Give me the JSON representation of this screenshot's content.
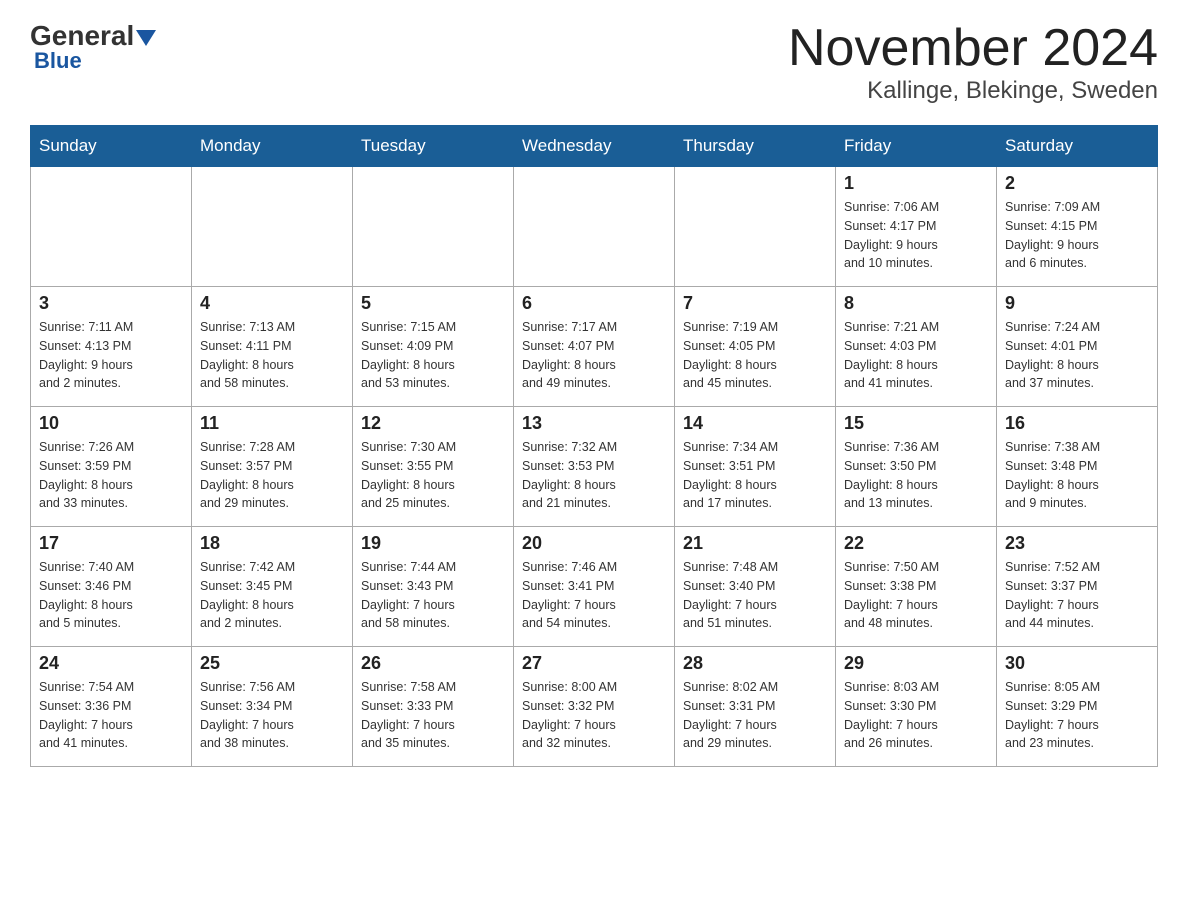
{
  "header": {
    "logo_general": "General",
    "logo_blue": "Blue",
    "month_year": "November 2024",
    "location": "Kallinge, Blekinge, Sweden"
  },
  "weekdays": [
    "Sunday",
    "Monday",
    "Tuesday",
    "Wednesday",
    "Thursday",
    "Friday",
    "Saturday"
  ],
  "weeks": [
    {
      "days": [
        {
          "num": "",
          "info": "",
          "empty": true
        },
        {
          "num": "",
          "info": "",
          "empty": true
        },
        {
          "num": "",
          "info": "",
          "empty": true
        },
        {
          "num": "",
          "info": "",
          "empty": true
        },
        {
          "num": "",
          "info": "",
          "empty": true
        },
        {
          "num": "1",
          "info": "Sunrise: 7:06 AM\nSunset: 4:17 PM\nDaylight: 9 hours\nand 10 minutes."
        },
        {
          "num": "2",
          "info": "Sunrise: 7:09 AM\nSunset: 4:15 PM\nDaylight: 9 hours\nand 6 minutes."
        }
      ]
    },
    {
      "days": [
        {
          "num": "3",
          "info": "Sunrise: 7:11 AM\nSunset: 4:13 PM\nDaylight: 9 hours\nand 2 minutes."
        },
        {
          "num": "4",
          "info": "Sunrise: 7:13 AM\nSunset: 4:11 PM\nDaylight: 8 hours\nand 58 minutes."
        },
        {
          "num": "5",
          "info": "Sunrise: 7:15 AM\nSunset: 4:09 PM\nDaylight: 8 hours\nand 53 minutes."
        },
        {
          "num": "6",
          "info": "Sunrise: 7:17 AM\nSunset: 4:07 PM\nDaylight: 8 hours\nand 49 minutes."
        },
        {
          "num": "7",
          "info": "Sunrise: 7:19 AM\nSunset: 4:05 PM\nDaylight: 8 hours\nand 45 minutes."
        },
        {
          "num": "8",
          "info": "Sunrise: 7:21 AM\nSunset: 4:03 PM\nDaylight: 8 hours\nand 41 minutes."
        },
        {
          "num": "9",
          "info": "Sunrise: 7:24 AM\nSunset: 4:01 PM\nDaylight: 8 hours\nand 37 minutes."
        }
      ]
    },
    {
      "days": [
        {
          "num": "10",
          "info": "Sunrise: 7:26 AM\nSunset: 3:59 PM\nDaylight: 8 hours\nand 33 minutes."
        },
        {
          "num": "11",
          "info": "Sunrise: 7:28 AM\nSunset: 3:57 PM\nDaylight: 8 hours\nand 29 minutes."
        },
        {
          "num": "12",
          "info": "Sunrise: 7:30 AM\nSunset: 3:55 PM\nDaylight: 8 hours\nand 25 minutes."
        },
        {
          "num": "13",
          "info": "Sunrise: 7:32 AM\nSunset: 3:53 PM\nDaylight: 8 hours\nand 21 minutes."
        },
        {
          "num": "14",
          "info": "Sunrise: 7:34 AM\nSunset: 3:51 PM\nDaylight: 8 hours\nand 17 minutes."
        },
        {
          "num": "15",
          "info": "Sunrise: 7:36 AM\nSunset: 3:50 PM\nDaylight: 8 hours\nand 13 minutes."
        },
        {
          "num": "16",
          "info": "Sunrise: 7:38 AM\nSunset: 3:48 PM\nDaylight: 8 hours\nand 9 minutes."
        }
      ]
    },
    {
      "days": [
        {
          "num": "17",
          "info": "Sunrise: 7:40 AM\nSunset: 3:46 PM\nDaylight: 8 hours\nand 5 minutes."
        },
        {
          "num": "18",
          "info": "Sunrise: 7:42 AM\nSunset: 3:45 PM\nDaylight: 8 hours\nand 2 minutes."
        },
        {
          "num": "19",
          "info": "Sunrise: 7:44 AM\nSunset: 3:43 PM\nDaylight: 7 hours\nand 58 minutes."
        },
        {
          "num": "20",
          "info": "Sunrise: 7:46 AM\nSunset: 3:41 PM\nDaylight: 7 hours\nand 54 minutes."
        },
        {
          "num": "21",
          "info": "Sunrise: 7:48 AM\nSunset: 3:40 PM\nDaylight: 7 hours\nand 51 minutes."
        },
        {
          "num": "22",
          "info": "Sunrise: 7:50 AM\nSunset: 3:38 PM\nDaylight: 7 hours\nand 48 minutes."
        },
        {
          "num": "23",
          "info": "Sunrise: 7:52 AM\nSunset: 3:37 PM\nDaylight: 7 hours\nand 44 minutes."
        }
      ]
    },
    {
      "days": [
        {
          "num": "24",
          "info": "Sunrise: 7:54 AM\nSunset: 3:36 PM\nDaylight: 7 hours\nand 41 minutes."
        },
        {
          "num": "25",
          "info": "Sunrise: 7:56 AM\nSunset: 3:34 PM\nDaylight: 7 hours\nand 38 minutes."
        },
        {
          "num": "26",
          "info": "Sunrise: 7:58 AM\nSunset: 3:33 PM\nDaylight: 7 hours\nand 35 minutes."
        },
        {
          "num": "27",
          "info": "Sunrise: 8:00 AM\nSunset: 3:32 PM\nDaylight: 7 hours\nand 32 minutes."
        },
        {
          "num": "28",
          "info": "Sunrise: 8:02 AM\nSunset: 3:31 PM\nDaylight: 7 hours\nand 29 minutes."
        },
        {
          "num": "29",
          "info": "Sunrise: 8:03 AM\nSunset: 3:30 PM\nDaylight: 7 hours\nand 26 minutes."
        },
        {
          "num": "30",
          "info": "Sunrise: 8:05 AM\nSunset: 3:29 PM\nDaylight: 7 hours\nand 23 minutes."
        }
      ]
    }
  ]
}
